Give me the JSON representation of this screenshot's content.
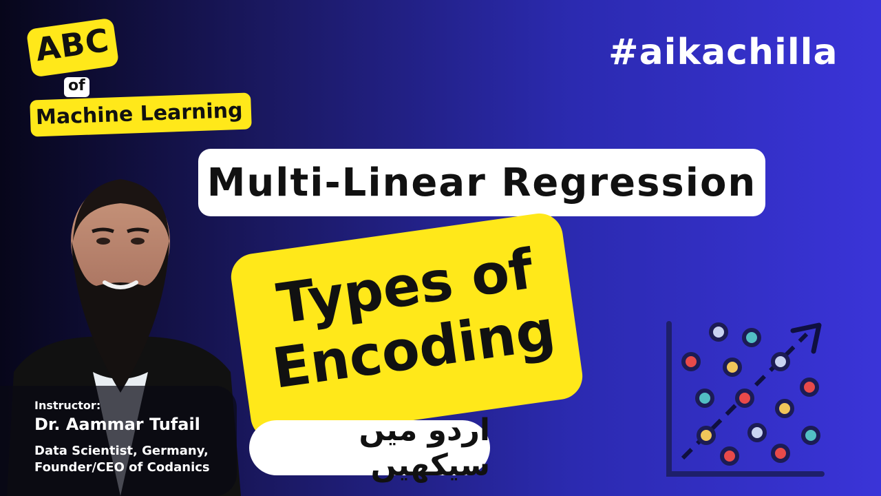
{
  "branding": {
    "abc": "ABC",
    "of": "of",
    "subject": "Machine Learning"
  },
  "hashtag": "#aikachilla",
  "title": "Multi-Linear Regression",
  "topic": {
    "line1": "Types of",
    "line2": "Encoding"
  },
  "urdu_tagline": "اردو میں سیکھیں",
  "instructor": {
    "label": "Instructor:",
    "name": "Dr. Aammar Tufail",
    "role_line1": "Data Scientist, Germany,",
    "role_line2": "Founder/CEO of Codanics"
  },
  "colors": {
    "accent_yellow": "#ffe81a",
    "bg_dark": "#07061a",
    "bg_blue": "#3a34d8"
  },
  "icons": {
    "scatter": "scatter-plot-icon"
  }
}
